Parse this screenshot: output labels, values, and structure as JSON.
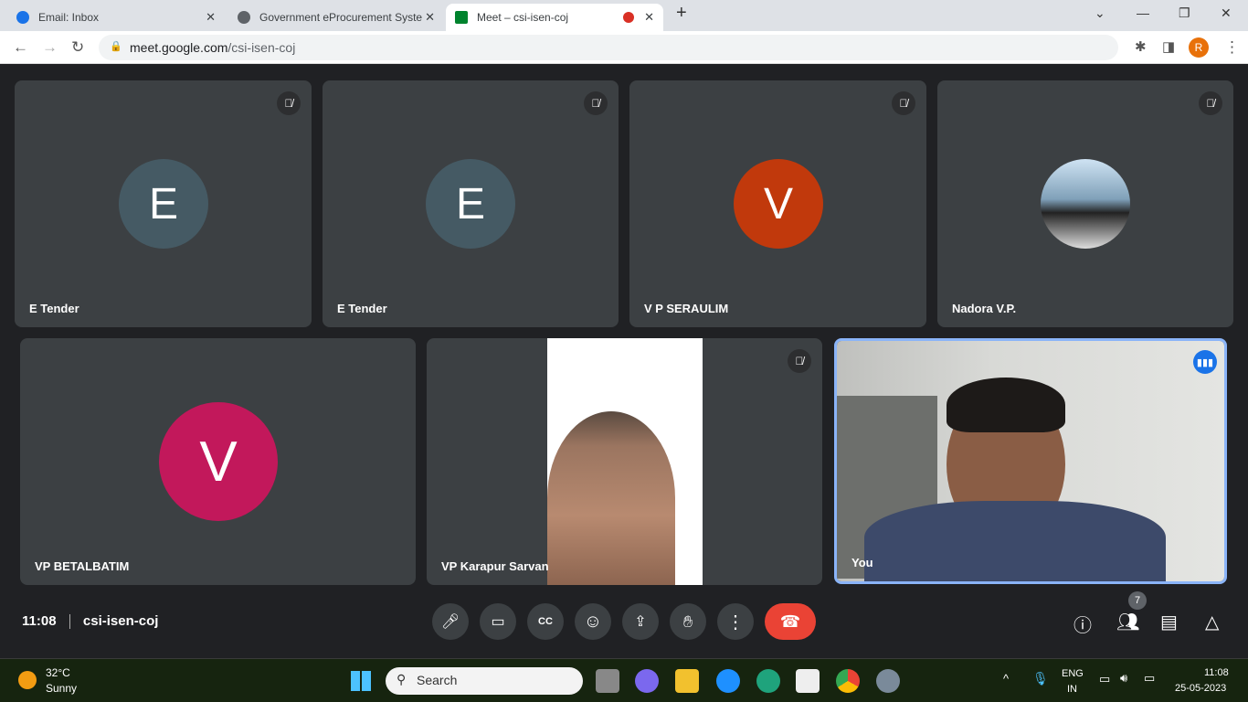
{
  "browser": {
    "tabs": [
      {
        "title": "Email: Inbox",
        "icon": "at-icon"
      },
      {
        "title": "Government eProcurement Syste",
        "icon": "globe-icon"
      },
      {
        "title": "Meet – csi-isen-coj",
        "icon": "meet-icon",
        "recording": true
      }
    ],
    "url_host": "meet.google.com",
    "url_path": "/csi-isen-coj",
    "profile_initial": "R"
  },
  "participants": [
    {
      "name": "E Tender",
      "initial": "E",
      "color": "#455a64",
      "muted": true
    },
    {
      "name": "E Tender",
      "initial": "E",
      "color": "#455a64",
      "muted": true
    },
    {
      "name": "V P SERAULIM",
      "initial": "V",
      "color": "#c1390c",
      "muted": true
    },
    {
      "name": "Nadora V.P.",
      "initial": "",
      "muted": true
    },
    {
      "name": "VP BETALBATIM",
      "initial": "V",
      "color": "#c2185b",
      "muted": false
    },
    {
      "name": "VP Karapur Sarvan",
      "initial": "",
      "muted": true
    },
    {
      "name": "You",
      "initial": "",
      "muted": false,
      "speaking": true
    }
  ],
  "meeting": {
    "time": "11:08",
    "code": "csi-isen-coj",
    "participant_count": "7"
  },
  "taskbar": {
    "temp": "32°C",
    "weather": "Sunny",
    "search": "Search",
    "lang1": "ENG",
    "lang2": "IN",
    "time": "11:08",
    "date": "25-05-2023"
  }
}
